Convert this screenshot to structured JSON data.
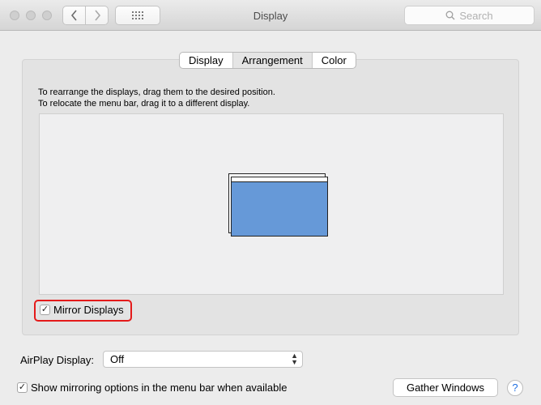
{
  "window": {
    "title": "Display"
  },
  "toolbar": {
    "search_placeholder": "Search"
  },
  "tabs": [
    {
      "label": "Display",
      "active": false
    },
    {
      "label": "Arrangement",
      "active": true
    },
    {
      "label": "Color",
      "active": false
    }
  ],
  "arrangement": {
    "instruction_line1": "To rearrange the displays, drag them to the desired position.",
    "instruction_line2": "To relocate the menu bar, drag it to a different display.",
    "mirror_displays": {
      "label": "Mirror Displays",
      "checked": true
    },
    "display_color": "#6699d8"
  },
  "airplay": {
    "label": "AirPlay Display:",
    "value": "Off"
  },
  "show_mirroring": {
    "label": "Show mirroring options in the menu bar when available",
    "checked": true
  },
  "gather_windows_label": "Gather Windows",
  "help_label": "?",
  "checkmark": "✓"
}
